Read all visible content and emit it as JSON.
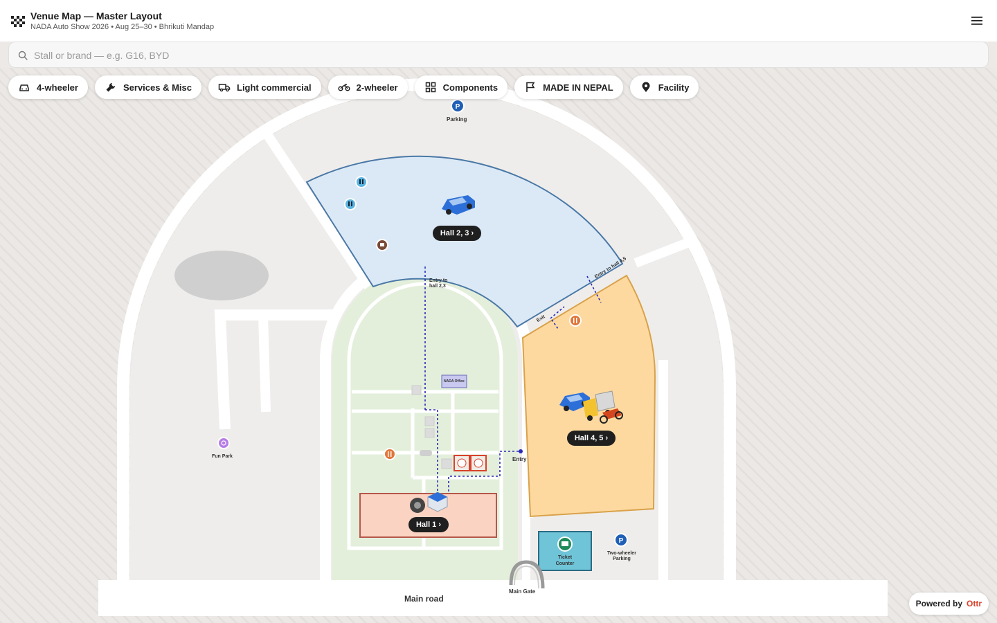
{
  "header": {
    "title": "Venue Map — Master Layout",
    "subtitle": "NADA Auto Show 2026 • Aug 25–30 • Bhrikuti Mandap",
    "logo_icon": "checkered-flag-icon",
    "menu_icon": "hamburger-menu-icon"
  },
  "search": {
    "placeholder": "Stall or brand — e.g. G16, BYD",
    "value": ""
  },
  "chips": [
    {
      "label": "4-wheeler",
      "icon": "car-icon"
    },
    {
      "label": "Services & Misc",
      "icon": "wrench-icon"
    },
    {
      "label": "Light commercial",
      "icon": "truck-icon"
    },
    {
      "label": "2-wheeler",
      "icon": "motorbike-icon"
    },
    {
      "label": "Components",
      "icon": "grid-icon"
    },
    {
      "label": "MADE IN NEPAL",
      "icon": "flag-icon"
    },
    {
      "label": "Facility",
      "icon": "location-pin-icon"
    }
  ],
  "map": {
    "parking_top": "Parking",
    "parking_letter": "P",
    "hall_23": "Hall 2, 3",
    "hall_45": "Hall 4, 5",
    "hall_1": "Hall 1",
    "entry_hall_23_line1": "Entry to",
    "entry_hall_23_line2": "hall 2,3",
    "entry_hall_45": "Entry to hall 4,5",
    "exit": "Exit",
    "entry": "Entry",
    "nada_office": "NADA Office",
    "fun_park": "Fun Park",
    "ticket_counter_line1": "Ticket",
    "ticket_counter_line2": "Counter",
    "two_wheeler_parking_line1": "Two-wheeler",
    "two_wheeler_parking_line2": "Parking",
    "main_gate": "Main Gate",
    "main_road": "Main road",
    "colors": {
      "hall_23_fill": "#dbe9f6",
      "hall_23_stroke": "#4a78a6",
      "hall_45_fill": "#fdd9a0",
      "hall_45_stroke": "#d9a24a",
      "hall_1_fill": "#fbd3c2",
      "hall_1_stroke": "#b5574b",
      "green_area": "#e3efdb",
      "path_blue": "#2a2ab5"
    }
  },
  "footer": {
    "powered_by": "Powered by",
    "brand": "Ottr"
  }
}
